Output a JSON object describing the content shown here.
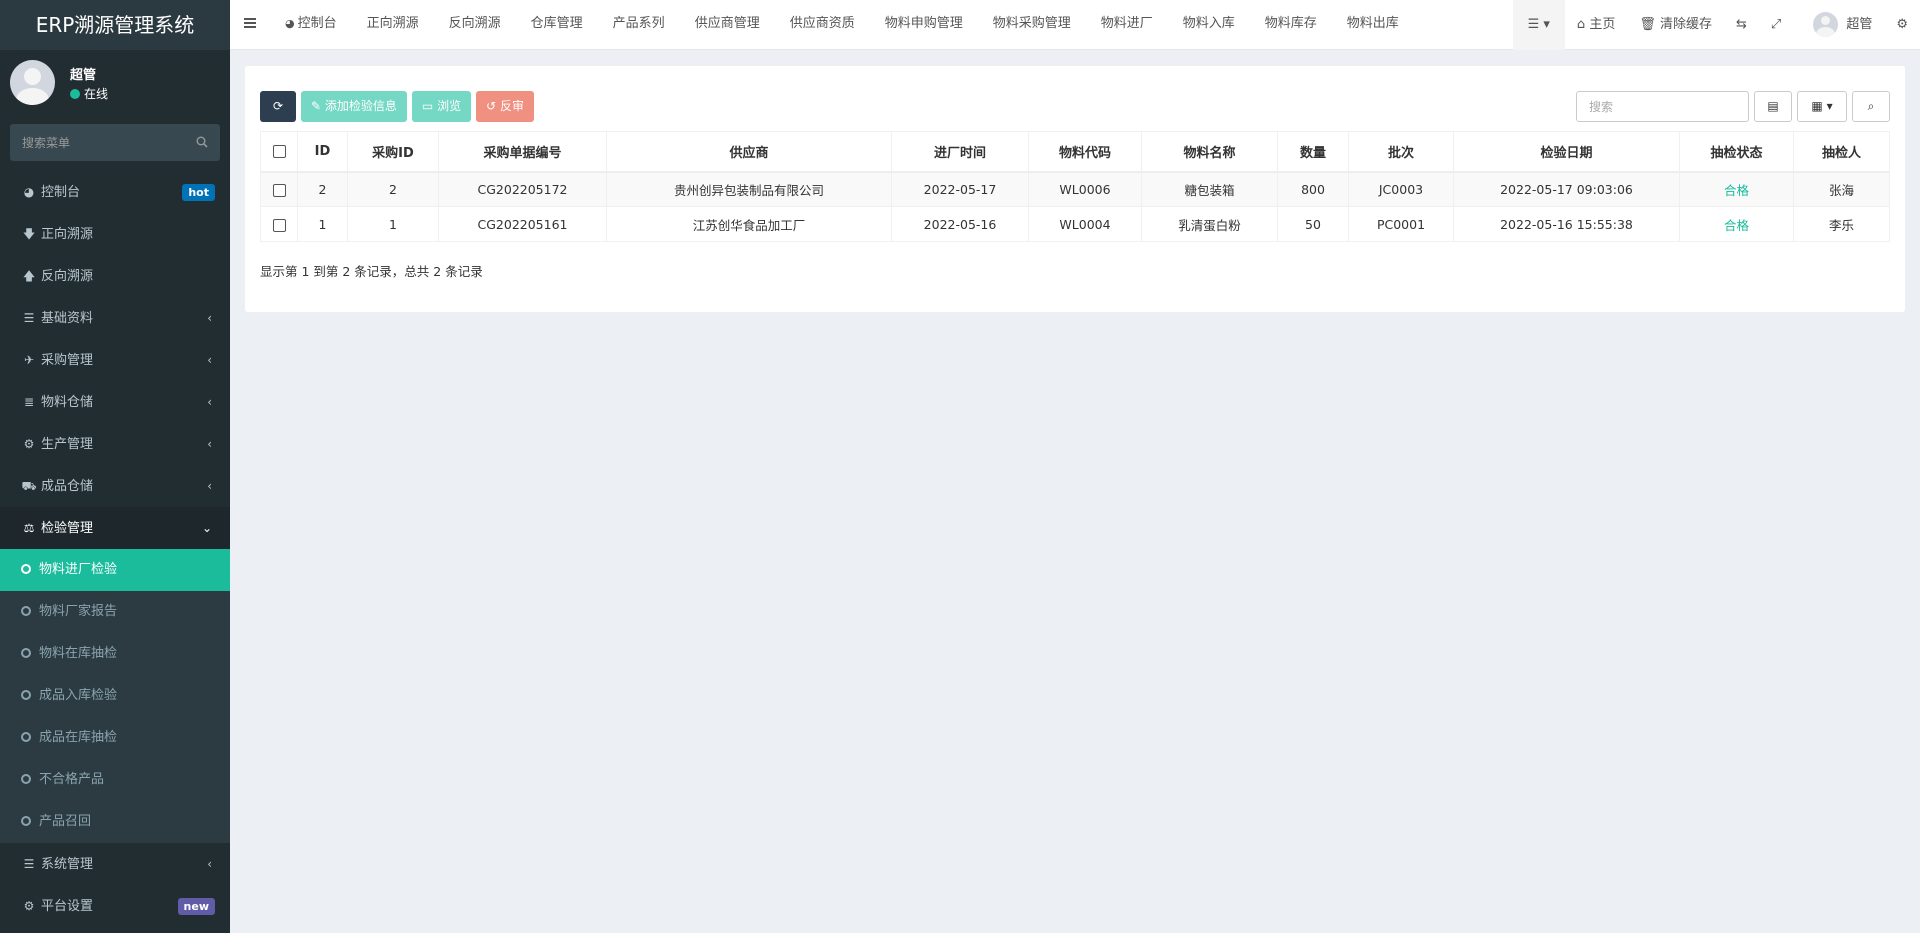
{
  "app": {
    "title": "ERP溯源管理系统"
  },
  "user": {
    "name": "超管",
    "status": "在线"
  },
  "sidebar": {
    "search_placeholder": "搜索菜单",
    "items": [
      {
        "label": "控制台",
        "icon": "dashboard-icon",
        "badge": "hot"
      },
      {
        "label": "正向溯源",
        "icon": "arrow-down-icon"
      },
      {
        "label": "反向溯源",
        "icon": "arrow-up-icon"
      },
      {
        "label": "基础资料",
        "icon": "list-icon"
      },
      {
        "label": "采购管理",
        "icon": "plane-icon"
      },
      {
        "label": "物料仓储",
        "icon": "database-icon"
      },
      {
        "label": "生产管理",
        "icon": "cogs-icon"
      },
      {
        "label": "成品仓储",
        "icon": "road-icon"
      },
      {
        "label": "检验管理",
        "icon": "balance-scale-icon"
      }
    ],
    "submenu": [
      {
        "label": "物料进厂检验",
        "active": true
      },
      {
        "label": "物料厂家报告"
      },
      {
        "label": "物料在库抽检"
      },
      {
        "label": "成品入库检验"
      },
      {
        "label": "成品在库抽检"
      },
      {
        "label": "不合格产品"
      },
      {
        "label": "产品召回"
      }
    ],
    "bottom_items": [
      {
        "label": "系统管理",
        "icon": "list-icon"
      },
      {
        "label": "平台设置",
        "icon": "cogs-icon",
        "badge": "new"
      }
    ]
  },
  "navbar": {
    "tabs": [
      "控制台",
      "正向溯源",
      "反向溯源",
      "仓库管理",
      "产品系列",
      "供应商管理",
      "供应商资质",
      "物料申购管理",
      "物料采购管理",
      "物料进厂",
      "物料入库",
      "物料库存",
      "物料出库"
    ],
    "home_label": "主页",
    "clear_cache_label": "清除缓存",
    "user_label": "超管"
  },
  "toolbar": {
    "add_label": "添加检验信息",
    "view_label": "浏览",
    "review_label": "反审",
    "search_placeholder": "搜索"
  },
  "table": {
    "headers": [
      "ID",
      "采购ID",
      "采购单据编号",
      "供应商",
      "进厂时间",
      "物料代码",
      "物料名称",
      "数量",
      "批次",
      "检验日期",
      "抽检状态",
      "抽检人"
    ],
    "rows": [
      [
        "2",
        "2",
        "CG202205172",
        "贵州创异包装制品有限公司",
        "2022-05-17",
        "WL0006",
        "糖包装箱",
        "800",
        "JC0003",
        "2022-05-17 09:03:06",
        "合格",
        "张海"
      ],
      [
        "1",
        "1",
        "CG202205161",
        "江苏创华食品加工厂",
        "2022-05-16",
        "WL0004",
        "乳清蛋白粉",
        "50",
        "PC0001",
        "2022-05-16 15:55:38",
        "合格",
        "李乐"
      ]
    ]
  },
  "pagination": {
    "info": "显示第 1 到第 2 条记录，总共 2 条记录"
  },
  "colors": {
    "sidebar_bg": "#222d32",
    "active_teal": "#1abc9c",
    "status_ok": "#18bc9c",
    "badge_hot": "#0073b7",
    "badge_new": "#605ca8"
  }
}
